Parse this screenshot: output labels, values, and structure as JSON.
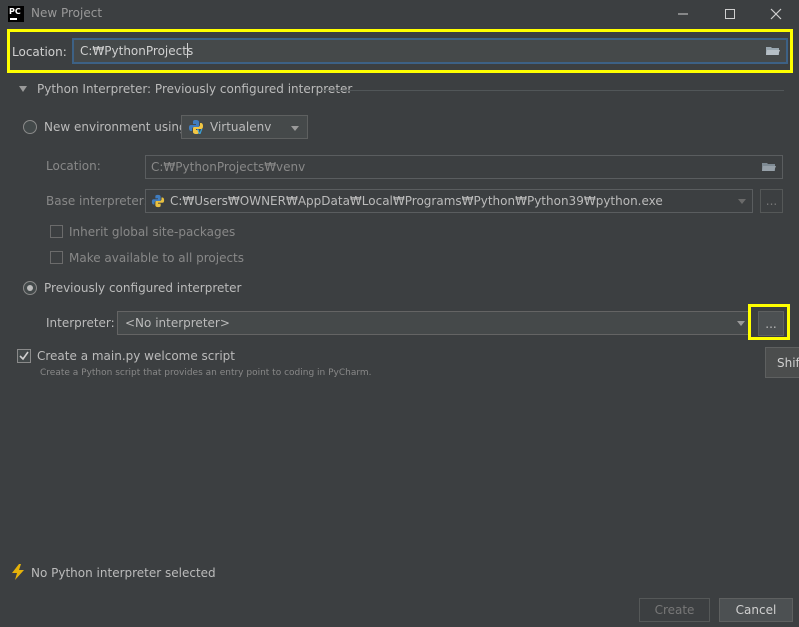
{
  "window": {
    "title": "New Project",
    "app_logo_text": "PC",
    "minimize_icon": "minimize-icon",
    "maximize_icon": "maximize-icon",
    "close_icon": "close-icon"
  },
  "location": {
    "label": "Location:",
    "value": "C:₩PythonProjects",
    "icon": "folder-icon"
  },
  "interpreter_section": {
    "title": "Python Interpreter: Previously configured interpreter",
    "expanded": true
  },
  "new_env": {
    "label": "New environment using",
    "tool": "Virtualenv",
    "location_label": "Location:",
    "location_value": "C:₩PythonProjects₩venv",
    "base_label": "Base interpreter:",
    "base_value": "C:₩Users₩OWNER₩AppData₩Local₩Programs₩Python₩Python39₩python.exe",
    "browse_label": "...",
    "inherit_label": "Inherit global site-packages",
    "available_label": "Make available to all projects"
  },
  "prev_configured": {
    "label": "Previously configured interpreter",
    "interpreter_label": "Interpreter:",
    "interpreter_value": "<No interpreter>",
    "browse_label": "...",
    "tooltip": "Shift"
  },
  "welcome_script": {
    "label": "Create a main.py welcome script",
    "checked": true,
    "description": "Create a Python script that provides an entry point to coding in PyCharm."
  },
  "status": {
    "icon": "lightning-icon",
    "text": "No Python interpreter selected"
  },
  "buttons": {
    "create": "Create",
    "cancel": "Cancel"
  },
  "colors": {
    "background": "#3c3f41",
    "highlight": "#ffff00",
    "focus_border": "#3d6185"
  }
}
